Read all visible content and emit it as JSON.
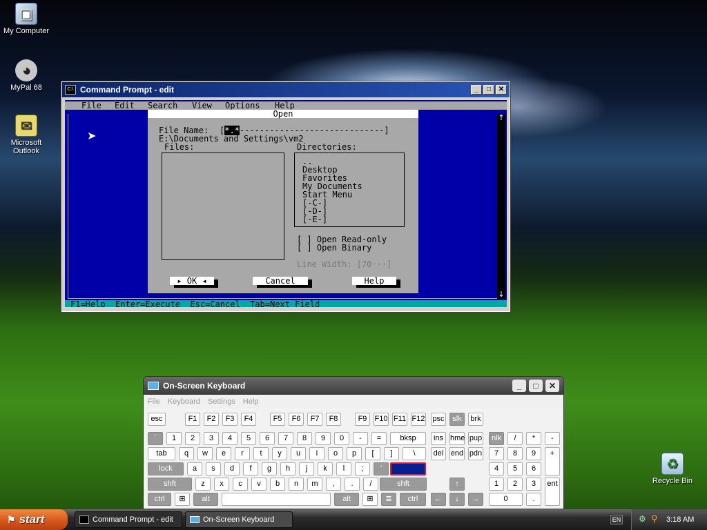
{
  "desktop": {
    "icons": [
      {
        "label": "My Computer"
      },
      {
        "label": "MyPal 68"
      },
      {
        "label": "Microsoft\nOutlook"
      },
      {
        "label": "Recycle Bin"
      }
    ]
  },
  "cmd_window": {
    "title": "Command Prompt - edit",
    "icon_text": "C:\\",
    "menu": [
      "File",
      "Edit",
      "Search",
      "View",
      "Options",
      "Help"
    ],
    "dialog": {
      "title": "Open",
      "file_name_label": "File Name:",
      "file_name_value": "*.*",
      "path": "E:\\Documents and Settings\\vm2",
      "files_label": "Files:",
      "dirs_label": "Directories:",
      "directories": [
        "..",
        "Desktop",
        "Favorites",
        "My Documents",
        "Start Menu",
        "[-C-]",
        "[-D-]",
        "[-E-]"
      ],
      "open_readonly": "[ ] Open Read-only",
      "open_binary": "[ ] Open Binary",
      "line_width": "Line Width: [70···]",
      "ok": "OK",
      "cancel": "Cancel",
      "help": "Help"
    },
    "status_bar": "F1=Help  Enter=Execute  Esc=Cancel  Tab=Next Field"
  },
  "osk": {
    "title": "On-Screen Keyboard",
    "menu": [
      "File",
      "Keyboard",
      "Settings",
      "Help"
    ],
    "highlighted_key": "enter"
  },
  "taskbar": {
    "start_label": "start",
    "tasks": [
      {
        "label": "Command Prompt - edit"
      },
      {
        "label": "On-Screen Keyboard"
      }
    ],
    "language": "EN",
    "clock": "3:18 AM"
  },
  "colors": {
    "dos_blue": "#0000a8",
    "dialog_gray": "#a8a8a8",
    "osk_highlight": "#0a1f8f",
    "start_orange": "#d4541e"
  }
}
